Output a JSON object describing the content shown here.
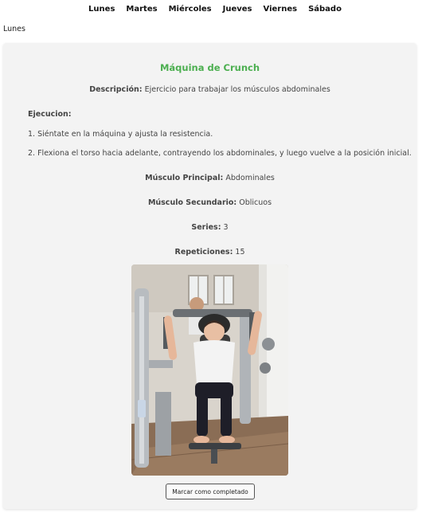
{
  "nav": {
    "days": [
      "Lunes",
      "Martes",
      "Miércoles",
      "Jueves",
      "Viernes",
      "Sábado"
    ]
  },
  "day_title": "Lunes",
  "exercise": {
    "name": "Máquina de Crunch",
    "description_label": "Descripción:",
    "description": "Ejercicio para trabajar los músculos abdominales",
    "execution_label": "Ejecucion:",
    "steps": [
      "1. Siéntate en la máquina y ajusta la resistencia.",
      "2. Flexiona el torso hacia adelante, contrayendo los abdominales, y luego vuelve a la posición inicial."
    ],
    "primary_muscle_label": "Músculo Principal:",
    "primary_muscle": "Abdominales",
    "secondary_muscle_label": "Músculo Secundario:",
    "secondary_muscle": "Oblicuos",
    "series_label": "Series:",
    "series": "3",
    "reps_label": "Repeticiones:",
    "reps": "15",
    "complete_button": "Marcar como completado"
  },
  "colors": {
    "accent": "#4caf50",
    "card_background": "#f3f3f3"
  }
}
